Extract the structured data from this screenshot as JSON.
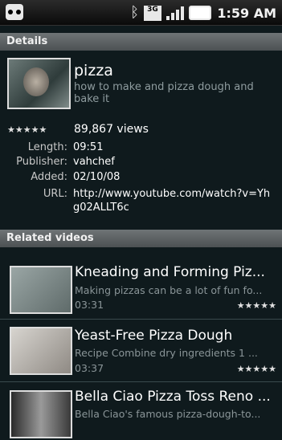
{
  "status": {
    "time": "1:59 AM",
    "network": "3G"
  },
  "details": {
    "header": "Details",
    "title": "pizza",
    "description": "how to make and pizza dough and bake it",
    "rating": "★★★★★",
    "views": "89,867 views",
    "length_label": "Length:",
    "length": "09:51",
    "publisher_label": "Publisher:",
    "publisher": "vahchef",
    "added_label": "Added:",
    "added": "02/10/08",
    "url_label": "URL:",
    "url_line1": "http://www.youtube.com/watch?v=Yh",
    "url_line2": "g02ALLT6c"
  },
  "related": {
    "header": "Related videos",
    "items": [
      {
        "title": "Kneading and Forming Piz...",
        "description": "Making pizzas can be a lot of fun fo...",
        "duration": "03:31",
        "rating": "★★★★★"
      },
      {
        "title": "Yeast-Free Pizza Dough",
        "description": "Recipe  Combine dry ingredients 1 ...",
        "duration": "03:37",
        "rating": "★★★★★"
      },
      {
        "title": "Bella Ciao Pizza Toss Reno ...",
        "description": "Bella Ciao's famous pizza-dough-to...",
        "duration": "",
        "rating": ""
      }
    ]
  }
}
